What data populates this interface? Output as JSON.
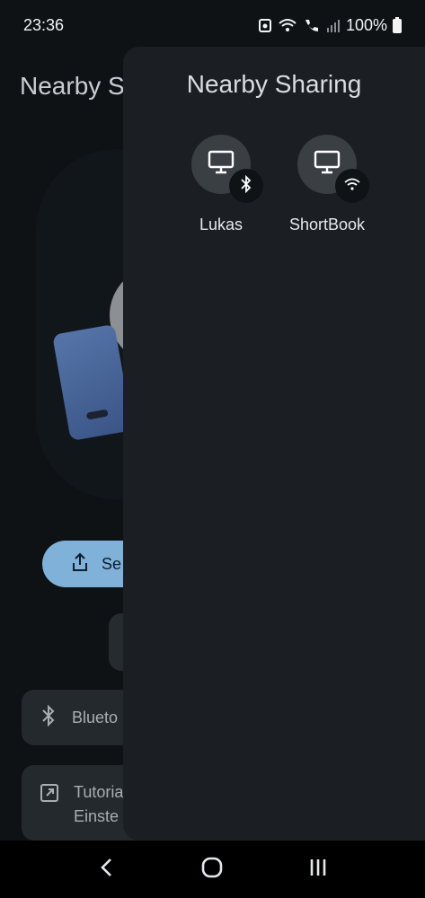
{
  "status_bar": {
    "time": "23:36",
    "battery_percent": "100%",
    "icons": [
      "android-notification-icon",
      "wifi-calling-icon",
      "volte-call-icon",
      "signal-icon",
      "battery-icon"
    ]
  },
  "background_page": {
    "title": "Nearby S",
    "send_button_label": "Se",
    "bluetooth_card_label": "Blueto",
    "tutorial_card_line1": "Tutoria",
    "tutorial_card_line2": "Einste"
  },
  "sheet": {
    "title": "Nearby Sharing",
    "devices": [
      {
        "name": "Lukas",
        "icon": "monitor-icon",
        "connection": "bluetooth-icon"
      },
      {
        "name": "ShortBook",
        "icon": "monitor-icon",
        "connection": "wifi-icon"
      }
    ]
  },
  "nav_bar": {
    "buttons": [
      "back-icon",
      "home-icon",
      "recents-icon"
    ]
  }
}
